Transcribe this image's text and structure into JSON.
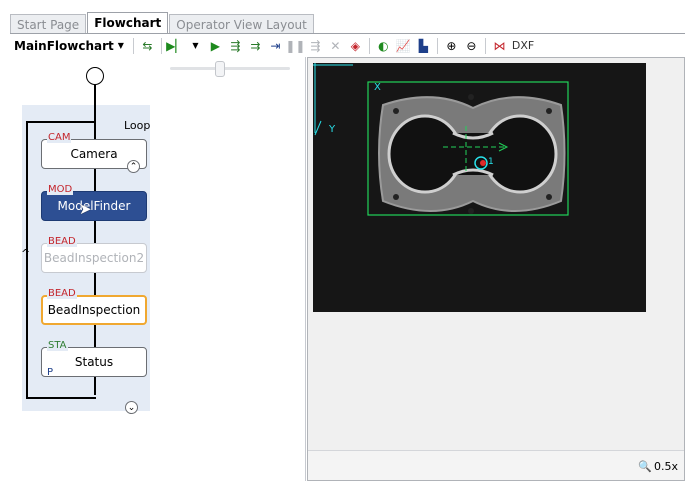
{
  "tabs": [
    {
      "label": "Start Page",
      "active": false
    },
    {
      "label": "Flowchart",
      "active": true
    },
    {
      "label": "Operator View Layout",
      "active": false
    }
  ],
  "toolbar": {
    "flowchart_select": "MainFlowchart",
    "dxf_label": "DXF"
  },
  "flowchart": {
    "loop_label": "Loop",
    "nodes": [
      {
        "tag": "CAM",
        "label": "Camera"
      },
      {
        "tag": "MOD",
        "label": "ModelFinder"
      },
      {
        "tag": "BEAD",
        "label": "BeadInspection2"
      },
      {
        "tag": "BEAD",
        "label": "BeadInspection"
      },
      {
        "tag": "STA",
        "label": "Status",
        "corner": "P"
      }
    ]
  },
  "viewer": {
    "x_axis_label": "X",
    "y_axis_label": "Y",
    "model_index": "1",
    "zoom": "0.5x"
  },
  "colors": {
    "selected_node": "#2d4f93",
    "highlight_border": "#f0a830",
    "overlay_green": "#22d35a",
    "overlay_cyan": "#28e0e8",
    "tag_red": "#c4252c"
  }
}
